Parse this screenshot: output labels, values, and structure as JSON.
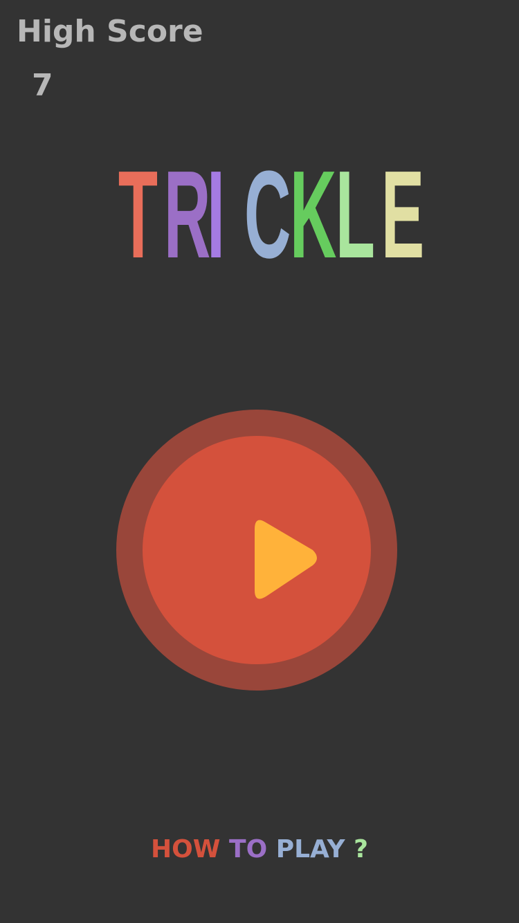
{
  "high_score": {
    "label": "High Score",
    "value": "7"
  },
  "title": {
    "letters": [
      {
        "char": "T",
        "color": "#e96e5a"
      },
      {
        "char": "R",
        "color": "#9b6fc6"
      },
      {
        "char": "I",
        "color": "#a57be3"
      },
      {
        "char": "C",
        "color": "#97afd4"
      },
      {
        "char": "K",
        "color": "#66cc5e"
      },
      {
        "char": "L",
        "color": "#a9e59d"
      },
      {
        "char": "E",
        "color": "#e1dfa3"
      }
    ]
  },
  "play_button": {
    "icon": "play-icon",
    "outer_color": "#99463a",
    "inner_color": "#d4513c",
    "icon_color": "#ffb23a"
  },
  "how_to_play": {
    "words": [
      {
        "text": "HOW",
        "color": "#d4513c"
      },
      {
        "text": "TO",
        "color": "#9b6fc6"
      },
      {
        "text": "PLAY",
        "color": "#97afd4"
      },
      {
        "text": "?",
        "color": "#a9e59d"
      }
    ]
  },
  "colors": {
    "background": "#333333",
    "score_text": "#b7b7b7"
  }
}
